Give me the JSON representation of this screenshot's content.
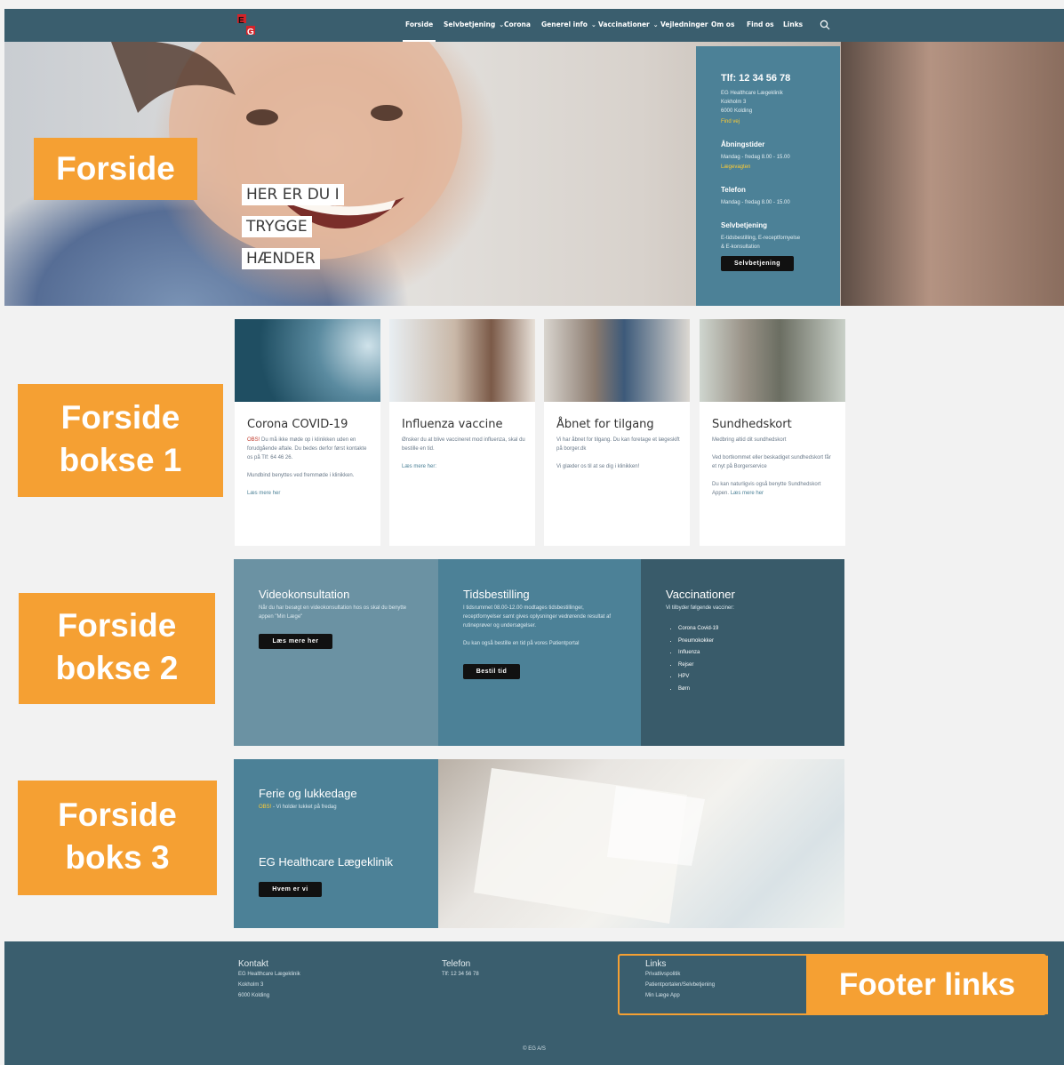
{
  "nav": {
    "logo_alt": "EG",
    "items": [
      {
        "label": "Forside",
        "caret": false
      },
      {
        "label": "Selvbetjening",
        "caret": true
      },
      {
        "label": "Corona",
        "caret": false
      },
      {
        "label": "Generel info",
        "caret": true
      },
      {
        "label": "Vaccinationer",
        "caret": true
      },
      {
        "label": "Vejledninger",
        "caret": false
      },
      {
        "label": "Om os",
        "caret": false
      },
      {
        "label": "Find os",
        "caret": false
      },
      {
        "label": "Links",
        "caret": false
      }
    ],
    "search_icon": "search-icon"
  },
  "hero": {
    "tag_lines": [
      "HER ER DU I",
      "TRYGGE",
      "HÆNDER"
    ]
  },
  "infopanel": {
    "phone": "Tlf: 12 34 56 78",
    "clinic_name": "EG Healthcare Lægeklinik",
    "street": "Kokholm 3",
    "city": "6000 Kolding",
    "find_link": "Find vej",
    "hours_heading": "Åbningstider",
    "hours_text": "Mandag - fredag 8.00 - 15.00",
    "hours_link": "Lægevagten",
    "phone_heading": "Telefon",
    "phone_text": "Mandag - fredag 8.00 - 15.00",
    "self_heading": "Selvbetjening",
    "self_text_1": "E-tidsbestilling, E-receptfornyelse",
    "self_text_2": "& E-konsultation",
    "self_button": "Selvbetjening"
  },
  "callouts": {
    "forside": "Forside",
    "bokse1_line1": "Forside",
    "bokse1_line2": "bokse 1",
    "bokse2_line1": "Forside",
    "bokse2_line2": "bokse 2",
    "boks3_line1": "Forside",
    "boks3_line2": "boks 3",
    "footer_links": "Footer links"
  },
  "cards": [
    {
      "title": "Corona COVID-19",
      "red": "OBS!",
      "p1": " Du må ikke møde op i klinikken uden en forudgående aftale. Du bedes derfor først kontakte os på Tlf: 64 46 26.",
      "p2": "Mundbind benyttes ved fremmøde i klinikken.",
      "link": "Læs mere her"
    },
    {
      "title": "Influenza vaccine",
      "p1": "Ønsker du at blive vaccineret mod influenza, skal du bestille en tid.",
      "p2": "Læs mere her:"
    },
    {
      "title": "Åbnet for tilgang",
      "p1": "Vi har åbnet for tilgang. Du kan foretage et lægeskift på borger.dk",
      "p2": "Vi glæder os til at se dig i klinikken!"
    },
    {
      "title": "Sundhedskort",
      "p1": "Medbring altid dit sundhedskort",
      "p2": "Ved bortkommet eller beskadiget sundhedskort får et nyt på Borgerservice",
      "p3": "Du kan naturligvis også benytte Sundhedskort Appen.",
      "link": "Læs mere her"
    }
  ],
  "boxes2": [
    {
      "title": "Videokonsultation",
      "text": "Når du har besøgt en videokonsultation hos os skal du benytte appen \"Min Læge\"",
      "button": "Læs mere her"
    },
    {
      "title": "Tidsbestilling",
      "text": "I tidsrummet 08.00-12.00 modtages tidsbestillinger, receptfornyelser samt gives oplysninger vedrørende resultat af rutineprøver og undersøgelser.",
      "text2": "Du kan også bestille en tid på vores Patientportal",
      "button": "Bestil tid"
    },
    {
      "title": "Vaccinationer",
      "text": "Vi tilbyder følgende vacciner:",
      "items": [
        "Corona Covid-19",
        "Pneumokokker",
        "Influenza",
        "Rejser",
        "HPV",
        "Børn"
      ]
    }
  ],
  "box3": {
    "title": "Ferie og lukkedage",
    "obs": "OBS!",
    "obs_text": " - Vi holder lukket på fredag",
    "clinic_title": "EG Healthcare Lægeklinik",
    "button": "Hvem er vi"
  },
  "footer": {
    "contact_heading": "Kontakt",
    "contact_lines": [
      "EG Healthcare Lægeklinik",
      "Kokholm 3",
      "6000 Kolding"
    ],
    "phone_heading": "Telefon",
    "phone_text": "Tlf: 12 34 56 78",
    "links_heading": "Links",
    "links": [
      "Privatlivspolitik",
      "Patientportalen/Selvbetjening",
      "Min Læge App"
    ],
    "copyright": "© EG A/S"
  },
  "colors": {
    "nav": "#3a5e6e",
    "panel": "#4c8197",
    "callout": "#f5a033"
  }
}
